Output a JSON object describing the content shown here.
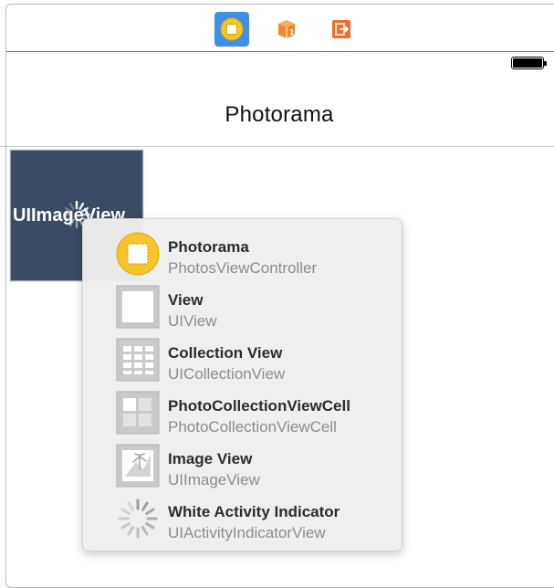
{
  "dock": {
    "items": [
      {
        "name": "view-controller-icon",
        "selected": true
      },
      {
        "name": "first-responder-icon",
        "selected": false
      },
      {
        "name": "exit-icon",
        "selected": false
      }
    ]
  },
  "scene": {
    "nav_title": "Photorama",
    "image_view_label": "UIImageView"
  },
  "popup": {
    "items": [
      {
        "title": "Photorama",
        "subtitle": "PhotosViewController",
        "icon": "view-controller-icon"
      },
      {
        "title": "View",
        "subtitle": "UIView",
        "icon": "view-icon"
      },
      {
        "title": "Collection View",
        "subtitle": "UICollectionView",
        "icon": "collection-view-icon"
      },
      {
        "title": "PhotoCollectionViewCell",
        "subtitle": "PhotoCollectionViewCell",
        "icon": "collection-cell-icon"
      },
      {
        "title": "Image View",
        "subtitle": "UIImageView",
        "icon": "image-view-icon"
      },
      {
        "title": "White Activity Indicator",
        "subtitle": "UIActivityIndicatorView",
        "icon": "activity-indicator-icon"
      }
    ]
  },
  "colors": {
    "accent": "#3f8fe6",
    "image_view_bg": "#3a4b63",
    "view_controller_yellow": "#f7c52b",
    "object_orange": "#f0852f"
  }
}
